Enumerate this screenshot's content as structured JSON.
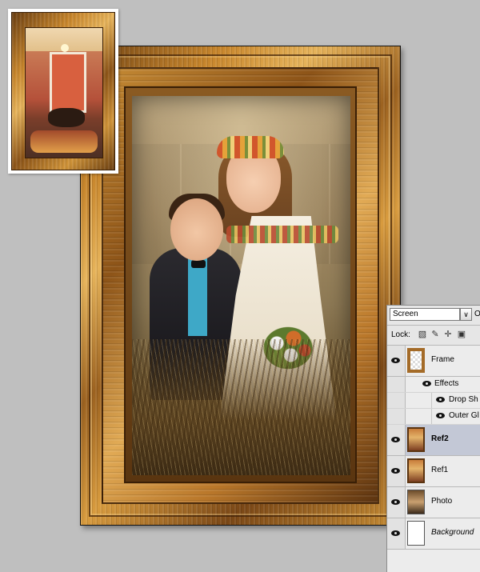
{
  "layers_panel": {
    "blend_mode": "Screen",
    "blend_cut_label": "O",
    "lock_label": "Lock:",
    "lock_icons": [
      "transparency-lock-icon",
      "brush-lock-icon",
      "move-lock-icon",
      "padlock-icon"
    ],
    "layers": [
      {
        "name": "Frame",
        "effects_label": "Effects",
        "effects": [
          "Drop Sh",
          "Outer Gl"
        ]
      },
      {
        "name": "Ref2",
        "selected": true
      },
      {
        "name": "Ref1"
      },
      {
        "name": "Photo"
      },
      {
        "name": "Background"
      }
    ]
  }
}
